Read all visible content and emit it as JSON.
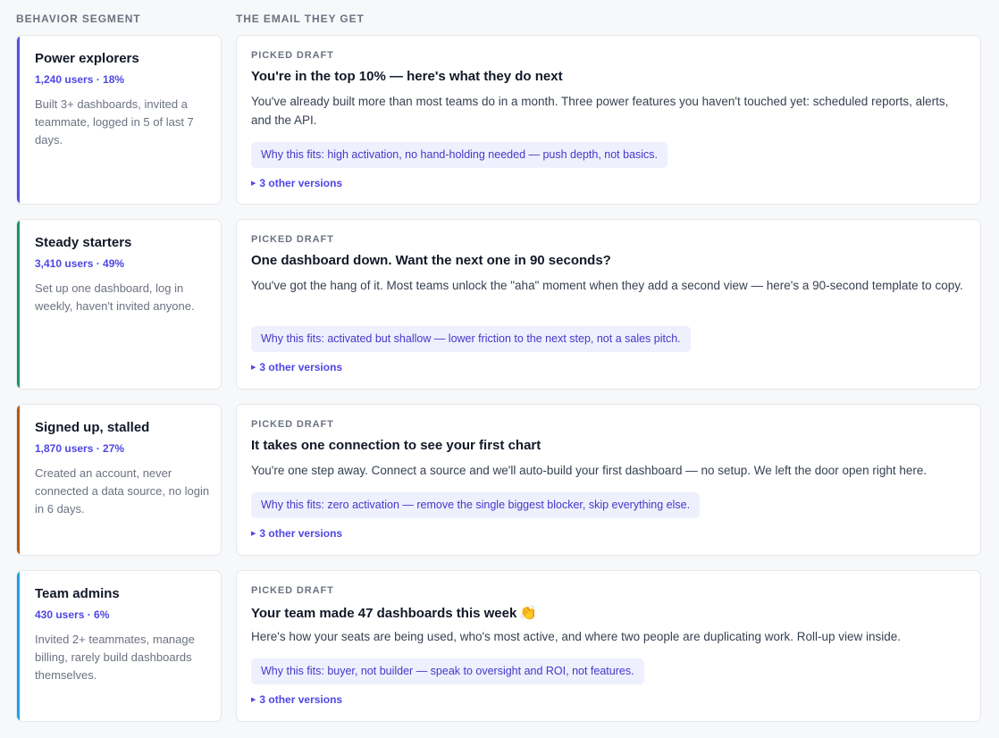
{
  "headers": {
    "segment": "BEHAVIOR SEGMENT",
    "email": "THE EMAIL THEY GET"
  },
  "rows": [
    {
      "accent": "#5b4ee6",
      "segment": {
        "title": "Power explorers",
        "stats": "1,240 users · 18%",
        "description": "Built 3+ dashboards, invited a teammate, logged in 5 of last 7 days."
      },
      "email": {
        "picked_label": "PICKED DRAFT",
        "subject": "You're in the top 10% — here's what they do next",
        "subject_emoji": "",
        "body": "You've already built more than most teams do in a month. Three power features you haven't touched yet: scheduled reports, alerts, and the API.",
        "why": "Why this fits: high activation, no hand-holding needed — push depth, not basics.",
        "other_versions": "3 other versions"
      }
    },
    {
      "accent": "#15956b",
      "segment": {
        "title": "Steady starters",
        "stats": "3,410 users · 49%",
        "description": "Set up one dashboard, log in weekly, haven't invited anyone."
      },
      "email": {
        "picked_label": "PICKED DRAFT",
        "subject": "One dashboard down. Want the next one in 90 seconds?",
        "subject_emoji": "",
        "body": "You've got the hang of it. Most teams unlock the \"aha\" moment when they add a second view — here's a 90-second template to copy.",
        "why": "Why this fits: activated but shallow — lower friction to the next step, not a sales pitch.",
        "other_versions": "3 other versions"
      }
    },
    {
      "accent": "#b85510",
      "segment": {
        "title": "Signed up, stalled",
        "stats": "1,870 users · 27%",
        "description": "Created an account, never connected a data source, no login in 6 days."
      },
      "email": {
        "picked_label": "PICKED DRAFT",
        "subject": "It takes one connection to see your first chart",
        "subject_emoji": "",
        "body": "You're one step away. Connect a source and we'll auto-build your first dashboard — no setup. We left the door open right here.",
        "why": "Why this fits: zero activation — remove the single biggest blocker, skip everything else.",
        "other_versions": "3 other versions"
      }
    },
    {
      "accent": "#1ba3e0",
      "segment": {
        "title": "Team admins",
        "stats": "430 users · 6%",
        "description": "Invited 2+ teammates, manage billing, rarely build dashboards themselves."
      },
      "email": {
        "picked_label": "PICKED DRAFT",
        "subject": "Your team made 47 dashboards this week",
        "subject_emoji": "👏",
        "body": "Here's how your seats are being used, who's most active, and where two people are duplicating work. Roll-up view inside.",
        "why": "Why this fits: buyer, not builder — speak to oversight and ROI, not features.",
        "other_versions": "3 other versions"
      }
    }
  ]
}
